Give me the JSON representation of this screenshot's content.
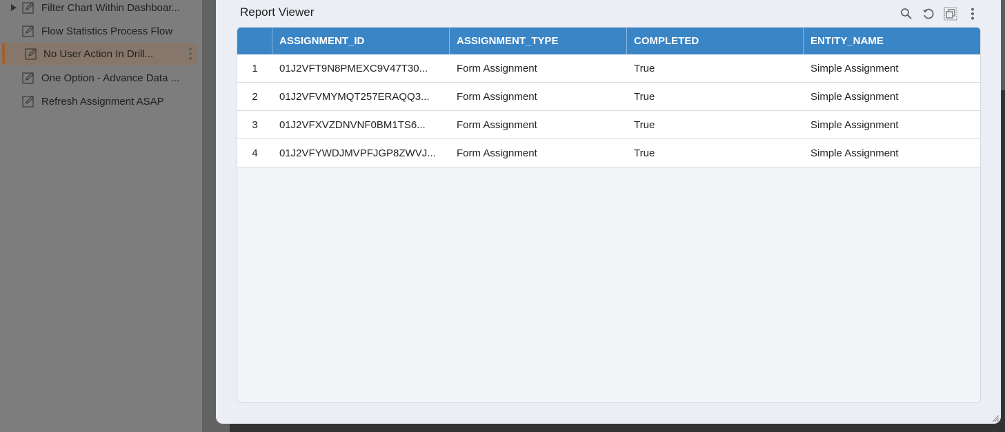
{
  "sidebar": {
    "items": [
      {
        "label": "Filter Chart Within Dashboar...",
        "expandable": true,
        "active": false
      },
      {
        "label": "Flow Statistics Process Flow",
        "expandable": false,
        "active": false
      },
      {
        "label": "No User Action In Drill...",
        "expandable": false,
        "active": true
      },
      {
        "label": "One Option - Advance Data ...",
        "expandable": false,
        "active": false
      },
      {
        "label": "Refresh Assignment ASAP",
        "expandable": false,
        "active": false
      }
    ],
    "active_color": "#a3602a"
  },
  "modal": {
    "title": "Report Viewer",
    "toolbar": {
      "icons": [
        "search-icon",
        "refresh-icon",
        "copy-icon",
        "more-vertical-icon"
      ]
    },
    "table": {
      "header_color": "#3a85c6",
      "columns": [
        "",
        "ASSIGNMENT_ID",
        "ASSIGNMENT_TYPE",
        "COMPLETED",
        "ENTITY_NAME"
      ],
      "rows": [
        {
          "num": "1",
          "assignment_id": "01J2VFT9N8PMEXC9V47T30...",
          "assignment_type": "Form Assignment",
          "completed": "True",
          "entity_name": "Simple Assignment"
        },
        {
          "num": "2",
          "assignment_id": "01J2VFVMYMQT257ERAQQ3...",
          "assignment_type": "Form Assignment",
          "completed": "True",
          "entity_name": "Simple Assignment"
        },
        {
          "num": "3",
          "assignment_id": "01J2VFXVZDNVNF0BM1TS6...",
          "assignment_type": "Form Assignment",
          "completed": "True",
          "entity_name": "Simple Assignment"
        },
        {
          "num": "4",
          "assignment_id": "01J2VFYWDJMVPFJGP8ZWVJ...",
          "assignment_type": "Form Assignment",
          "completed": "True",
          "entity_name": "Simple Assignment"
        }
      ]
    }
  }
}
